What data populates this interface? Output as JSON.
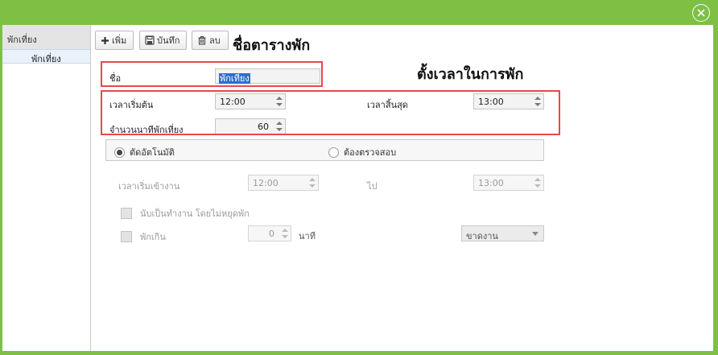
{
  "colors": {
    "brand": "#7dc043",
    "highlight": "#e8474f",
    "selection": "#2a6ecf"
  },
  "window": {
    "close_icon": "close-circle-icon"
  },
  "sidebar": {
    "header": "พักเที่ยง",
    "items": [
      {
        "label": "พักเที่ยง"
      }
    ]
  },
  "toolbar": {
    "add_label": "เพิ่ม",
    "save_label": "บันทึก",
    "delete_label": "ลบ"
  },
  "annotations": {
    "schedule_name": "ชื่อตารางพัก",
    "set_break_time": "ตั้งเวลาในการพัก"
  },
  "form": {
    "name_label": "ชื่อ",
    "name_value": "พักเที่ยง",
    "start_label": "เวลาเริ่มต้น",
    "start_value": "12:00",
    "end_label": "เวลาสิ้นสุด",
    "end_value": "13:00",
    "minutes_label": "จำนวนนาทีพักเที่ยง",
    "minutes_value": "60",
    "radio_auto": "ตัดอัตโนมัติ",
    "radio_check": "ต้องตรวจสอบ",
    "auto_selected": true,
    "work_start_label": "เวลาเริ่มเข้างาน",
    "work_start_value": "12:00",
    "to_label": "ไป",
    "to_value": "13:00",
    "count_as_work_label": "นับเป็นทำงาน โดยไม่หยุดพัก",
    "over_break_label": "พักเกิน",
    "over_break_value": "0",
    "minutes_unit": "นาที",
    "absence_option": "ขาดงาน"
  }
}
